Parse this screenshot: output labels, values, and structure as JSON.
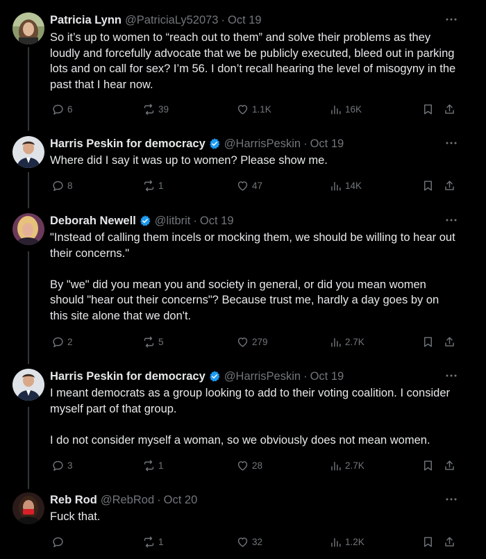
{
  "thread": {
    "more_icon": "ellipsis-icon",
    "tweets": [
      {
        "name": "Patricia Lynn",
        "verified": false,
        "handle": "@PatriciaLy52073",
        "time": "Oct 19",
        "text": "So it’s up to women to “reach out to them” and solve their problems as they loudly and forcefully advocate that we be publicly executed, bleed out in parking lots and on call for sex? I’m 56. I don’t recall hearing the level of misogyny in the past that I hear now.",
        "replies": "6",
        "reposts": "39",
        "likes": "1.1K",
        "views": "16K"
      },
      {
        "name": "Harris Peskin for democracy",
        "verified": true,
        "handle": "@HarrisPeskin",
        "time": "Oct 19",
        "text": "Where did I say it was up to women? Please show me.",
        "replies": "8",
        "reposts": "1",
        "likes": "47",
        "views": "14K"
      },
      {
        "name": "Deborah Newell",
        "verified": true,
        "handle": "@litbrit",
        "time": "Oct 19",
        "text": "\"Instead of calling them incels or mocking them, we should be willing to hear out their concerns.\"\n\nBy \"we\" did you mean you and society in general, or did you mean women should \"hear out their concerns\"? Because trust me, hardly a day goes by on this site alone that we don't.",
        "replies": "2",
        "reposts": "5",
        "likes": "279",
        "views": "2.7K"
      },
      {
        "name": "Harris Peskin for democracy",
        "verified": true,
        "handle": "@HarrisPeskin",
        "time": "Oct 19",
        "text": "I meant democrats as a group looking to add to their voting coalition. I consider myself part of that group.\n\nI do not consider myself a woman, so we obviously does not mean women.",
        "replies": "3",
        "reposts": "1",
        "likes": "28",
        "views": "2.7K"
      },
      {
        "name": "Reb Rod",
        "verified": false,
        "handle": "@RebRod",
        "time": "Oct 20",
        "text": "Fuck that.",
        "replies": "",
        "reposts": "1",
        "likes": "32",
        "views": "1.2K"
      }
    ]
  },
  "colors": {
    "background": "#000000",
    "text": "#e7e9ea",
    "muted": "#71767b",
    "verified": "#1d9bf0",
    "thread_line": "#333639"
  }
}
